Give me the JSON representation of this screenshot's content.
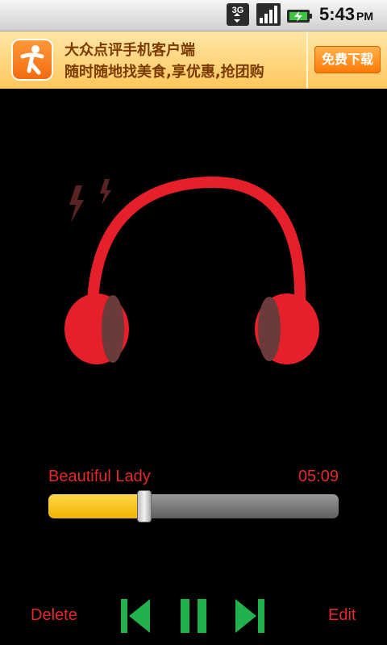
{
  "status_bar": {
    "network": "3G",
    "time": "5:43",
    "ampm": "PM",
    "icons": [
      "network-3g-icon",
      "signal-strength-icon",
      "battery-charging-icon"
    ]
  },
  "ad_banner": {
    "title": "大众点评手机客户端",
    "subtitle": "随时随地找美食,享优惠,抢团购",
    "button_label": "免费下载",
    "logo_icon": "dianping-logo-icon"
  },
  "player": {
    "artwork": "headphones-icon",
    "song_title": "Beautiful Lady",
    "duration": "05:09",
    "progress": 0.33,
    "controls": {
      "delete_label": "Delete",
      "edit_label": "Edit",
      "previous_icon": "skip-previous-icon",
      "pause_icon": "pause-icon",
      "next_icon": "skip-next-icon"
    }
  },
  "colors": {
    "accent_text": "#e2292b",
    "progress_fill": "#f3b400",
    "control_icon": "#22b14c",
    "headphone": "#e5202a",
    "ear_cup_shade": "#6b3a3a",
    "background": "#000000"
  }
}
